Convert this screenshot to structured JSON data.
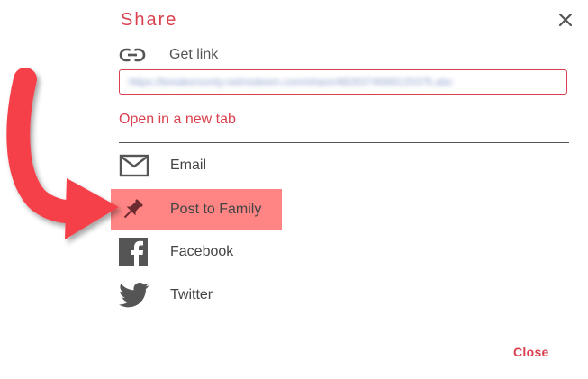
{
  "dialog": {
    "title": "Share",
    "close_icon": "close-x-icon"
  },
  "get_link": {
    "icon": "link-icon",
    "label": "Get link",
    "url": "https://breakersonly.net/redeem.com/share/4826374569120375.abc"
  },
  "open_new_tab": "Open in a new tab",
  "share_options": [
    {
      "icon": "email-icon",
      "label": "Email"
    },
    {
      "icon": "pin-icon",
      "label": "Post to Family",
      "highlighted": true
    },
    {
      "icon": "facebook-icon",
      "label": "Facebook"
    },
    {
      "icon": "twitter-icon",
      "label": "Twitter"
    }
  ],
  "close_button": "Close",
  "colors": {
    "accent": "#d9414f",
    "highlight": "#ff8585",
    "arrow": "#f5404a",
    "icon": "#555555"
  }
}
